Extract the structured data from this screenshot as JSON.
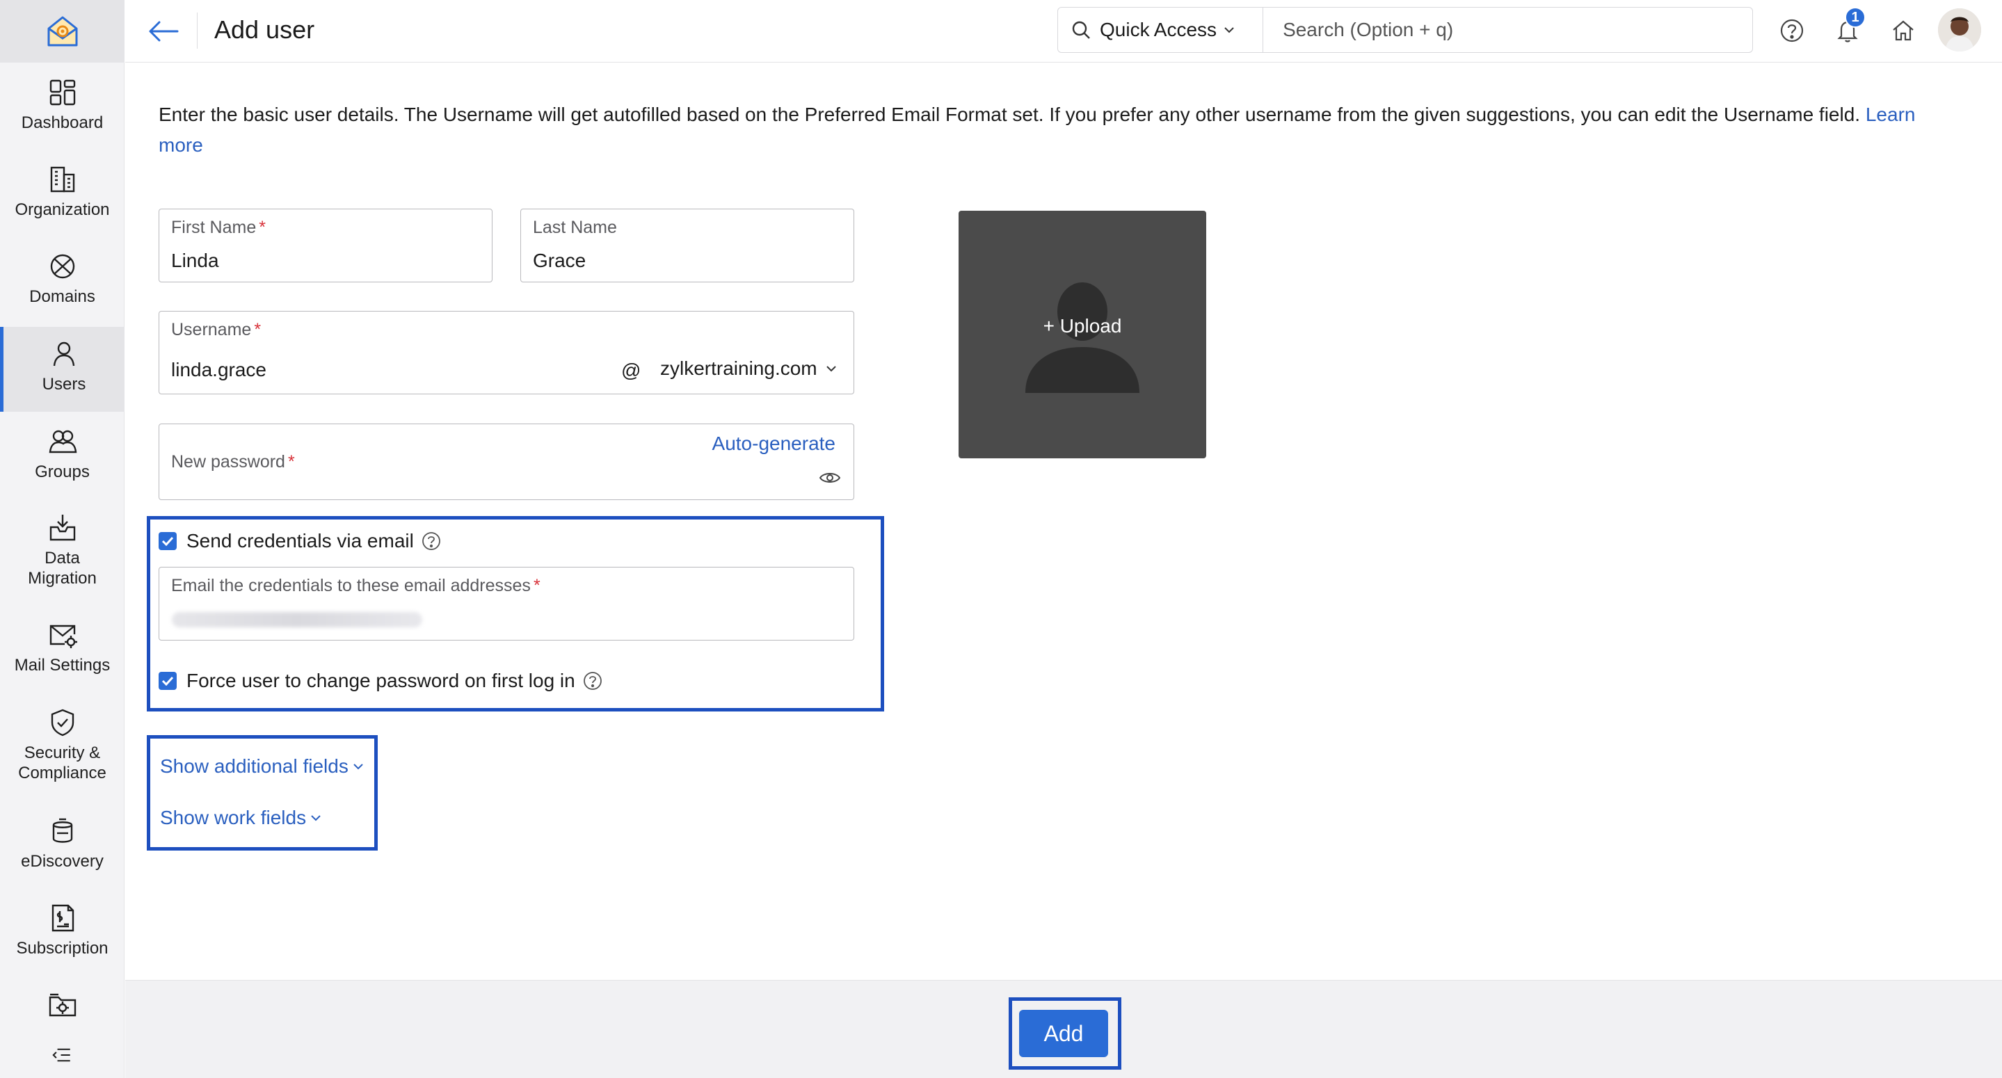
{
  "sidebar": {
    "items": [
      {
        "label": "Dashboard",
        "icon": "dashboard-icon"
      },
      {
        "label": "Organization",
        "icon": "organization-icon"
      },
      {
        "label": "Domains",
        "icon": "domains-icon"
      },
      {
        "label": "Users",
        "icon": "user-icon",
        "active": true
      },
      {
        "label": "Groups",
        "icon": "groups-icon"
      },
      {
        "label": "Data\nMigration",
        "icon": "data-migration-icon"
      },
      {
        "label": "Mail Settings",
        "icon": "mail-settings-icon"
      },
      {
        "label": "Security &\nCompliance",
        "icon": "shield-icon"
      },
      {
        "label": "eDiscovery",
        "icon": "ediscovery-icon"
      },
      {
        "label": "Subscription",
        "icon": "subscription-icon"
      }
    ]
  },
  "header": {
    "title": "Add user",
    "quick_access": "Quick Access",
    "search_placeholder": "Search (Option + q)",
    "notification_count": "1"
  },
  "intro": {
    "text": "Enter the basic user details. The Username will get autofilled based on the Preferred Email Format set. If you prefer any other username from the given suggestions, you can edit the Username field. ",
    "link": "Learn more"
  },
  "form": {
    "first_name": {
      "label": "First Name",
      "value": "Linda"
    },
    "last_name": {
      "label": "Last Name",
      "value": "Grace"
    },
    "username": {
      "label": "Username",
      "value": "linda.grace",
      "at": "@",
      "domain": "zylkertraining.com"
    },
    "password": {
      "label": "New password",
      "auto_generate": "Auto-generate"
    },
    "send_credentials": {
      "label": "Send credentials via email",
      "checked": true
    },
    "email_credentials": {
      "label": "Email the credentials to these email addresses"
    },
    "force_change": {
      "label": "Force user to change password on first log in",
      "checked": true
    },
    "show_additional": "Show additional fields",
    "show_work": "Show work fields"
  },
  "upload": {
    "label": "Upload"
  },
  "footer": {
    "add_label": "Add"
  },
  "colors": {
    "accent": "#2a6cd6",
    "highlight": "#1d4fbf",
    "link": "#2a5fbf",
    "required": "#d8323a"
  }
}
